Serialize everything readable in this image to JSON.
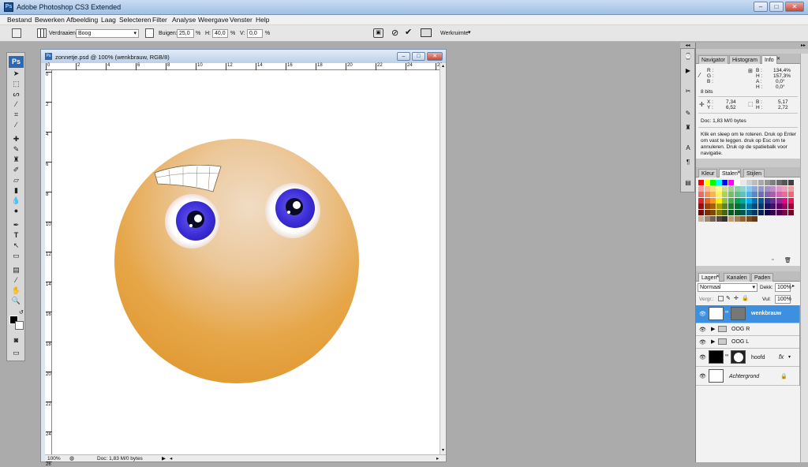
{
  "app": {
    "title": "Adobe Photoshop CS3 Extended"
  },
  "menu": [
    "Bestand",
    "Bewerken",
    "Afbeelding",
    "Laag",
    "Selecteren",
    "Filter",
    "Analyse",
    "Weergave",
    "Venster",
    "Help"
  ],
  "options": {
    "warp_label": "Verdraaien:",
    "warp_value": "Boog",
    "bend_label": "Buigen:",
    "bend_value": "25,0",
    "pct1": "%",
    "h_label": "H:",
    "h_value": "40,0",
    "pct2": "%",
    "v_label": "V:",
    "v_value": "0,0",
    "pct3": "%",
    "workspace": "Werkruimte"
  },
  "document": {
    "title": "zonnetje.psd @ 100% (wenkbrauw, RGB/8)",
    "zoom": "100%",
    "doc_info": "Doc: 1,83 M/0 bytes",
    "ruler_top": [
      "0",
      "2",
      "4",
      "6",
      "8",
      "10",
      "12",
      "14",
      "16",
      "18",
      "20",
      "22",
      "24",
      "26"
    ],
    "ruler_left": [
      "0",
      "2",
      "4",
      "6",
      "8",
      "10",
      "12",
      "14",
      "16",
      "18",
      "20",
      "22",
      "24",
      "26"
    ]
  },
  "info_panel": {
    "tabs": [
      "Navigator",
      "Histogram",
      "Info"
    ],
    "r": "R :",
    "g": "G :",
    "b": "B :",
    "bits": "8 bits",
    "b_val": "134,4%",
    "h_val": "157,3%",
    "a_label": "A :",
    "a_val": "0,0°",
    "h2_label": "H :",
    "h2_val": "0,0°",
    "b_label": "B :",
    "h_label": "H :",
    "x_label": "X :",
    "x_val": "7,34",
    "y_label": "Y :",
    "y_val": "6,52",
    "b2_label": "B :",
    "b2_val": "5,17",
    "h3_label": "H :",
    "h3_val": "2,72",
    "doc": "Doc: 1,83 M/0 bytes",
    "hint": "Klik en sleep om te roteren. Druk op Enter om vast te leggen. druk op Esc om te annuleren. Druk op de spatiebalk voor navigatie."
  },
  "swatch_panel": {
    "tabs": [
      "Kleur",
      "Stalen",
      "Stijlen"
    ]
  },
  "layers_panel": {
    "tabs": [
      "Lagen",
      "Kanalen",
      "Paden"
    ],
    "blend": "Normaal",
    "opacity_label": "Dekk:",
    "opacity": "100%",
    "lock_label": "Vergr.:",
    "fill_label": "Vul:",
    "fill": "100%",
    "layers": [
      "wenkbrauw",
      "OOG R",
      "OOG L",
      "hoofd",
      "Achtergrond"
    ],
    "fx": "fx"
  }
}
